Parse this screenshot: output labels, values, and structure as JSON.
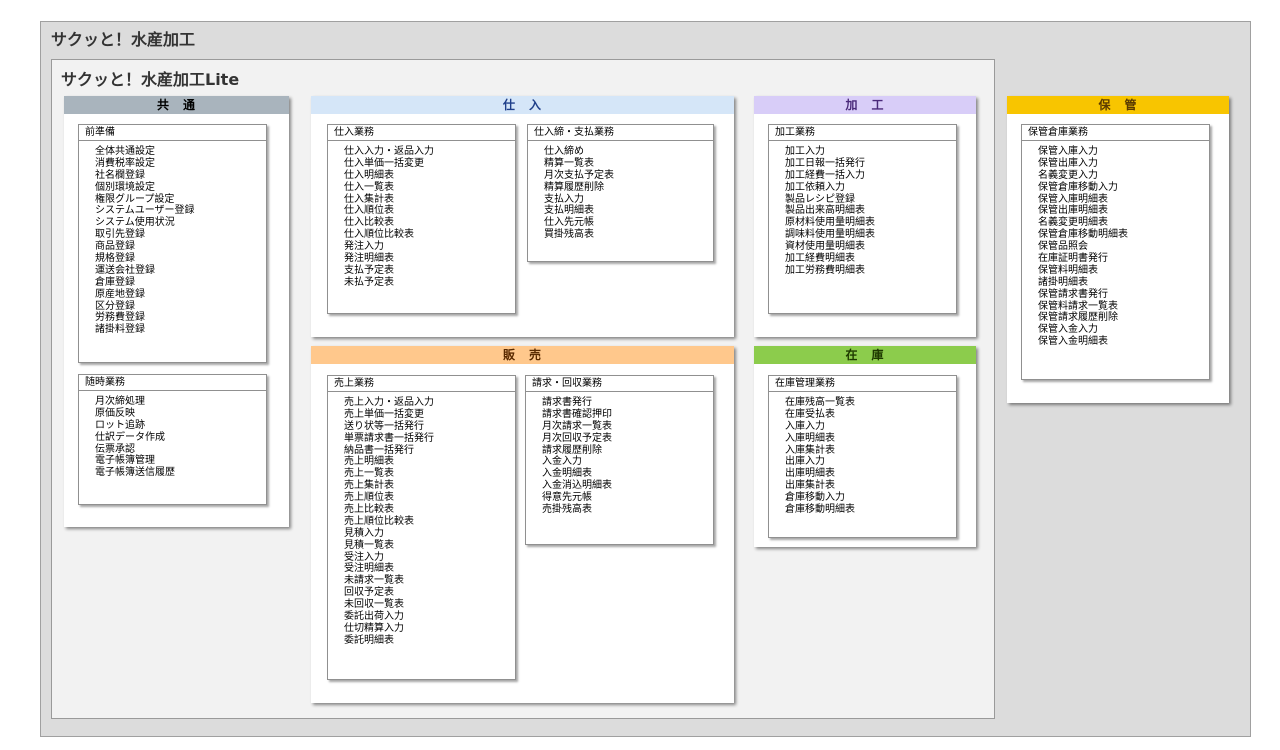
{
  "outer_title": "サクッと！水産加工",
  "inner_title": "サクッと！水産加工Lite",
  "sections": {
    "common": {
      "title": "共　通",
      "color": "#a9b4bd",
      "boxes": [
        {
          "title": "前準備",
          "items": [
            "全体共通設定",
            "消費税率設定",
            "社名欄登録",
            "個別環境設定",
            "権限グループ設定",
            "システムユーザー登録",
            "システム使用状況",
            "取引先登録",
            "商品登録",
            "規格登録",
            "運送会社登録",
            "倉庫登録",
            "原産地登録",
            "区分登録",
            "労務費登録",
            "諸掛料登録"
          ]
        },
        {
          "title": "随時業務",
          "items": [
            "月次締処理",
            "原価反映",
            "ロット追跡",
            "仕訳データ作成",
            "伝票承認",
            "電子帳簿管理",
            "電子帳簿送信履歴"
          ]
        }
      ]
    },
    "purchase": {
      "title": "仕　入",
      "color": "#d5e6f8",
      "text_color": "#1f3f8a",
      "boxes": [
        {
          "title": "仕入業務",
          "items": [
            "仕入入力・返品入力",
            "仕入単価一括変更",
            "仕入明細表",
            "仕入一覧表",
            "仕入集計表",
            "仕入順位表",
            "仕入比較表",
            "仕入順位比較表",
            "発注入力",
            "発注明細表",
            "支払予定表",
            "未払予定表"
          ]
        },
        {
          "title": "仕入締・支払業務",
          "items": [
            "仕入締め",
            "精算一覧表",
            "月次支払予定表",
            "精算履歴削除",
            "支払入力",
            "支払明細表",
            "仕入先元帳",
            "買掛残高表"
          ]
        }
      ]
    },
    "processing": {
      "title": "加　工",
      "color": "#d8cdf8",
      "text_color": "#4a2a7a",
      "boxes": [
        {
          "title": "加工業務",
          "items": [
            "加工入力",
            "加工日報一括発行",
            "加工経費一括入力",
            "加工依頼入力",
            "製品レシピ登録",
            "製品出来高明細表",
            "原材料使用量明細表",
            "調味料使用量明細表",
            "資材使用量明細表",
            "加工経費明細表",
            "加工労務費明細表"
          ]
        }
      ]
    },
    "storage": {
      "title": "保　管",
      "color": "#f8c500",
      "text_color": "#5a3a00",
      "boxes": [
        {
          "title": "保管倉庫業務",
          "items": [
            "保管入庫入力",
            "保管出庫入力",
            "名義変更入力",
            "保管倉庫移動入力",
            "保管入庫明細表",
            "保管出庫明細表",
            "名義変更明細表",
            "保管倉庫移動明細表",
            "保管品照会",
            "在庫証明書発行",
            "保管料明細表",
            "諸掛明細表",
            "保管請求書発行",
            "保管料請求一覧表",
            "保管請求履歴削除",
            "保管入金入力",
            "保管入金明細表"
          ]
        }
      ]
    },
    "sales": {
      "title": "販　売",
      "color": "#ffc88c",
      "text_color": "#5a2a00",
      "boxes": [
        {
          "title": "売上業務",
          "items": [
            "売上入力・返品入力",
            "売上単価一括変更",
            "送り状等一括発行",
            "単票請求書一括発行",
            "納品書一括発行",
            "売上明細表",
            "売上一覧表",
            "売上集計表",
            "売上順位表",
            "売上比較表",
            "売上順位比較表",
            "見積入力",
            "見積一覧表",
            "受注入力",
            "受注明細表",
            "未請求一覧表",
            "回収予定表",
            "未回収一覧表",
            "委託出荷入力",
            "仕切精算入力",
            "委託明細表"
          ]
        },
        {
          "title": "請求・回収業務",
          "items": [
            "請求書発行",
            "請求書確認押印",
            "月次請求一覧表",
            "月次回収予定表",
            "請求履歴削除",
            "入金入力",
            "入金明細表",
            "入金消込明細表",
            "得意先元帳",
            "売掛残高表"
          ]
        }
      ]
    },
    "inventory": {
      "title": "在　庫",
      "color": "#8ccc4c",
      "text_color": "#1e3a00",
      "boxes": [
        {
          "title": "在庫管理業務",
          "items": [
            "在庫残高一覧表",
            "在庫受払表",
            "入庫入力",
            "入庫明細表",
            "入庫集計表",
            "出庫入力",
            "出庫明細表",
            "出庫集計表",
            "倉庫移動入力",
            "倉庫移動明細表"
          ]
        }
      ]
    }
  }
}
